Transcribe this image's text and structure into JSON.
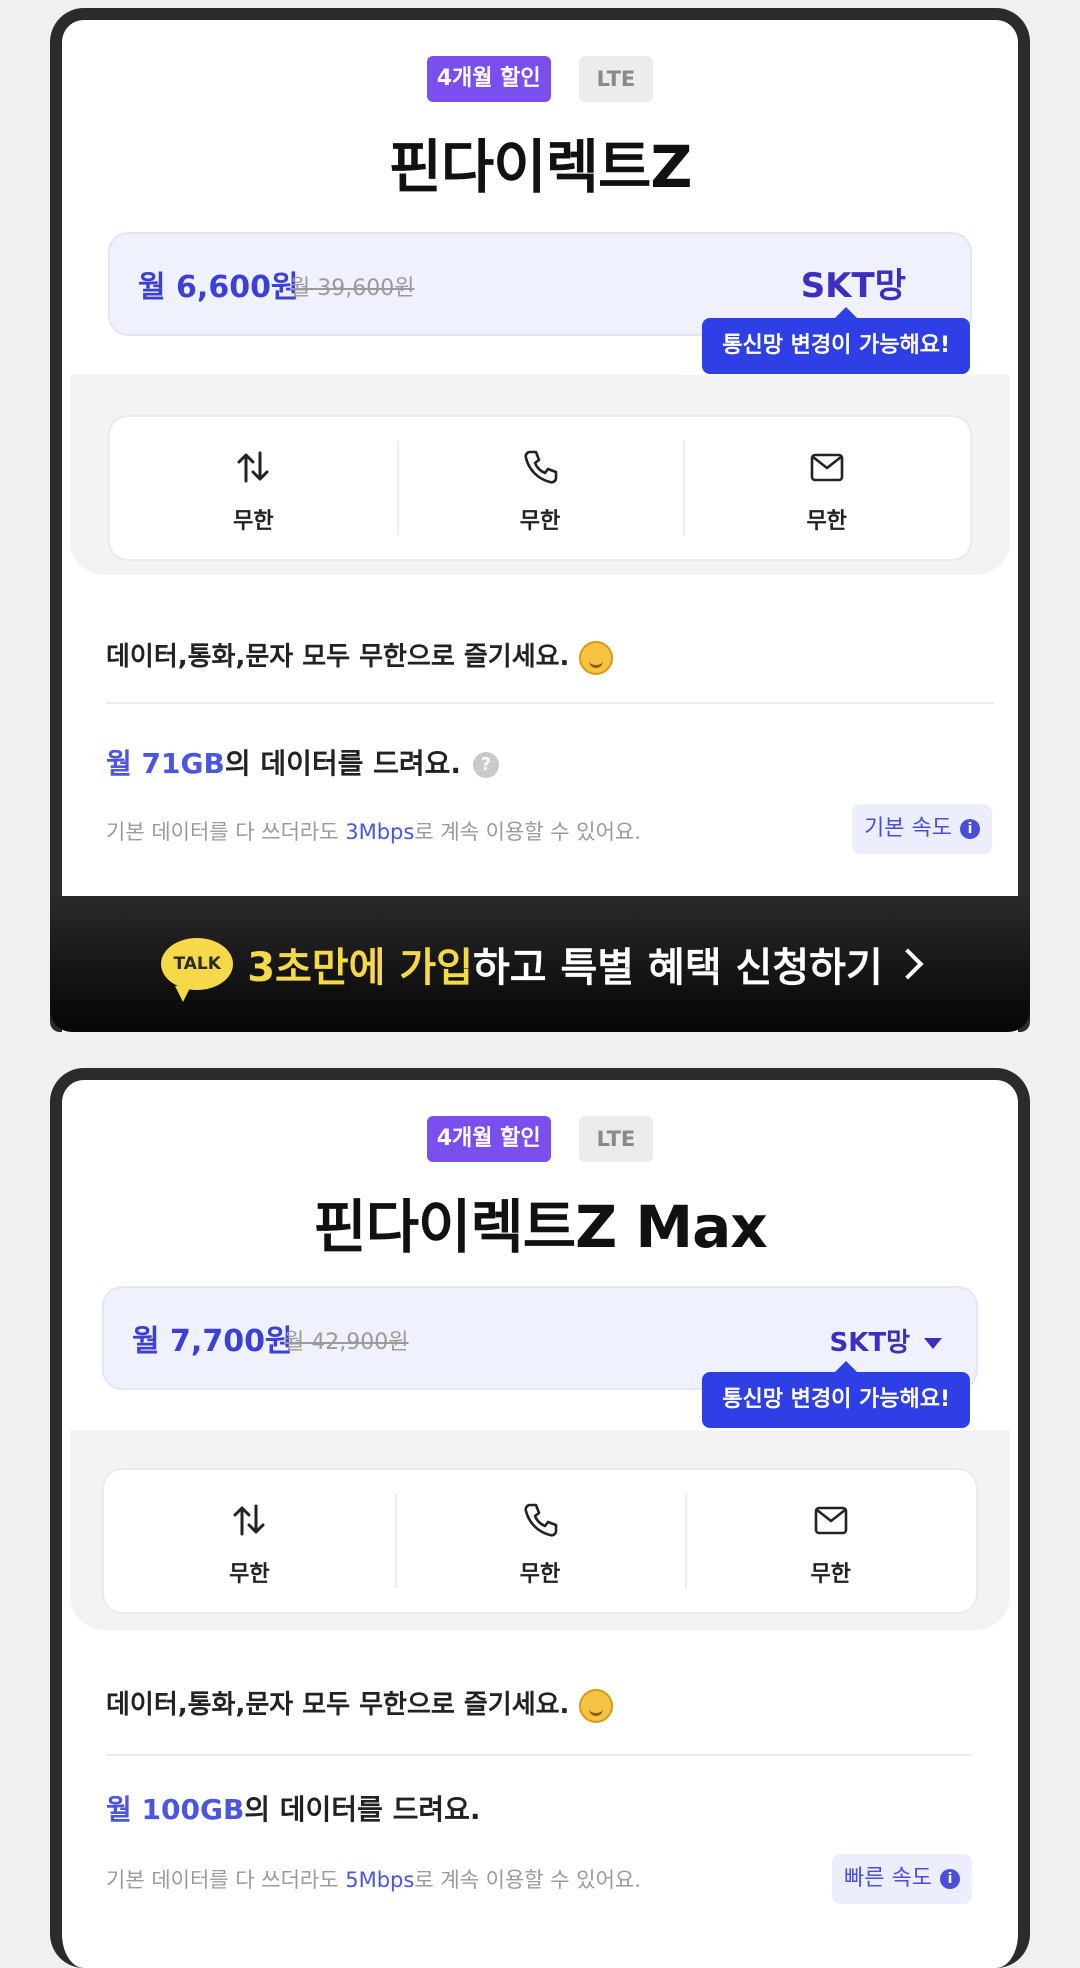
{
  "plans": [
    {
      "badge_discount": "4개월 할인",
      "badge_network": "LTE",
      "title": "핀다이렉트Z",
      "price": "월 6,600원",
      "price_original": "월 39,600원",
      "carrier": "SKT망",
      "tooltip": "통신망 변경이 가능해요!",
      "features": [
        {
          "icon": "data-transfer-icon",
          "label": "무한"
        },
        {
          "icon": "phone-icon",
          "label": "무한"
        },
        {
          "icon": "mail-icon",
          "label": "무한"
        }
      ],
      "tagline": "데이터,통화,문자 모두 무한으로 즐기세요.",
      "data_prefix": "월 71GB",
      "data_suffix": "의 데이터를 드려요.",
      "sub_prefix": "기본 데이터를 다 쓰더라도 ",
      "sub_speed": "3Mbps",
      "sub_suffix": "로 계속 이용할 수 있어요.",
      "speed_chip": "기본 속도"
    },
    {
      "badge_discount": "4개월 할인",
      "badge_network": "LTE",
      "title": "핀다이렉트Z Max",
      "price": "월 7,700원",
      "price_original": "월 42,900원",
      "carrier": "SKT망",
      "tooltip": "통신망 변경이 가능해요!",
      "features": [
        {
          "icon": "data-transfer-icon",
          "label": "무한"
        },
        {
          "icon": "phone-icon",
          "label": "무한"
        },
        {
          "icon": "mail-icon",
          "label": "무한"
        }
      ],
      "tagline": "데이터,통화,문자 모두 무한으로 즐기세요.",
      "data_prefix": "월 100GB",
      "data_suffix": "의 데이터를 드려요.",
      "sub_prefix": "기본 데이터를 다 쓰더라도 ",
      "sub_speed": "5Mbps",
      "sub_suffix": "로 계속 이용할 수 있어요.",
      "speed_chip": "빠른 속도"
    }
  ],
  "cta": {
    "talk_label": "TALK",
    "highlight": "3초만에 가입",
    "rest": "하고 특별 혜택 신청하기"
  },
  "colors": {
    "accent": "#3b41d8",
    "discount_badge": "#7b4ef0",
    "tooltip": "#2f3fe6",
    "kakao_yellow": "#f6d94a"
  }
}
